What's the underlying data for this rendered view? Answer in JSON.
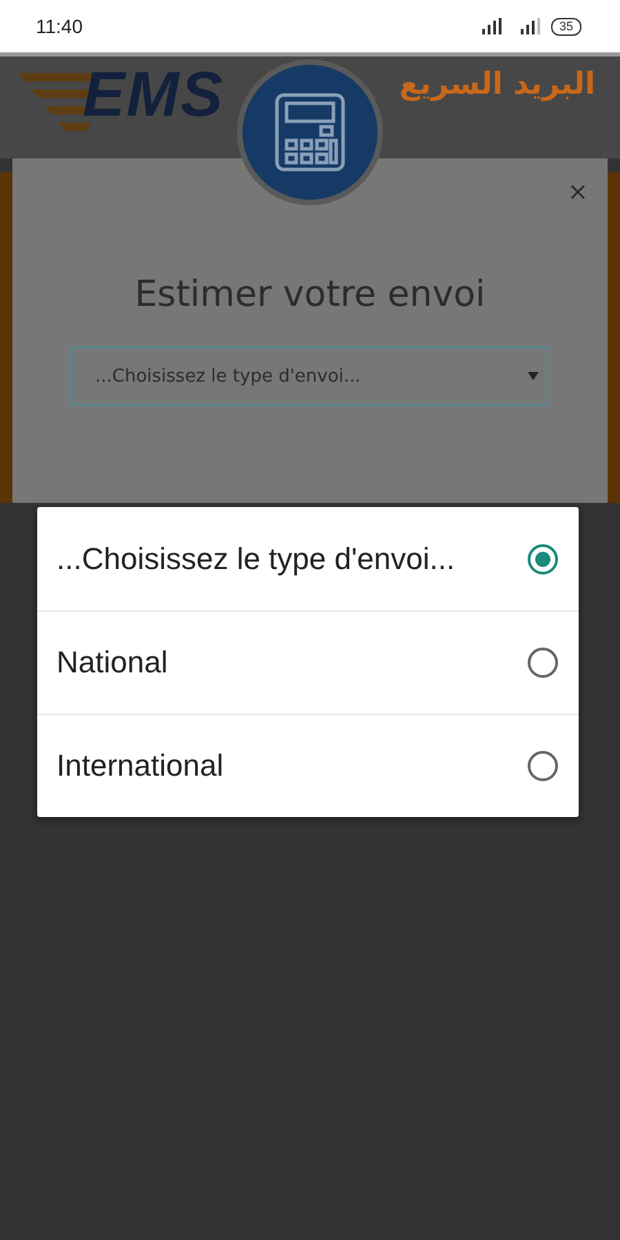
{
  "status_bar": {
    "time": "11:40",
    "battery": "35"
  },
  "header": {
    "logo_text": "EMS",
    "logo_arabic": "البريد السريع"
  },
  "modal": {
    "title": "Estimer votre envoi",
    "close": "×",
    "select": {
      "value": "...Choisissez le type d'envoi..."
    }
  },
  "picker": {
    "options": [
      {
        "label": "...Choisissez le type d'envoi...",
        "selected": true
      },
      {
        "label": "National",
        "selected": false
      },
      {
        "label": "International",
        "selected": false
      }
    ]
  }
}
